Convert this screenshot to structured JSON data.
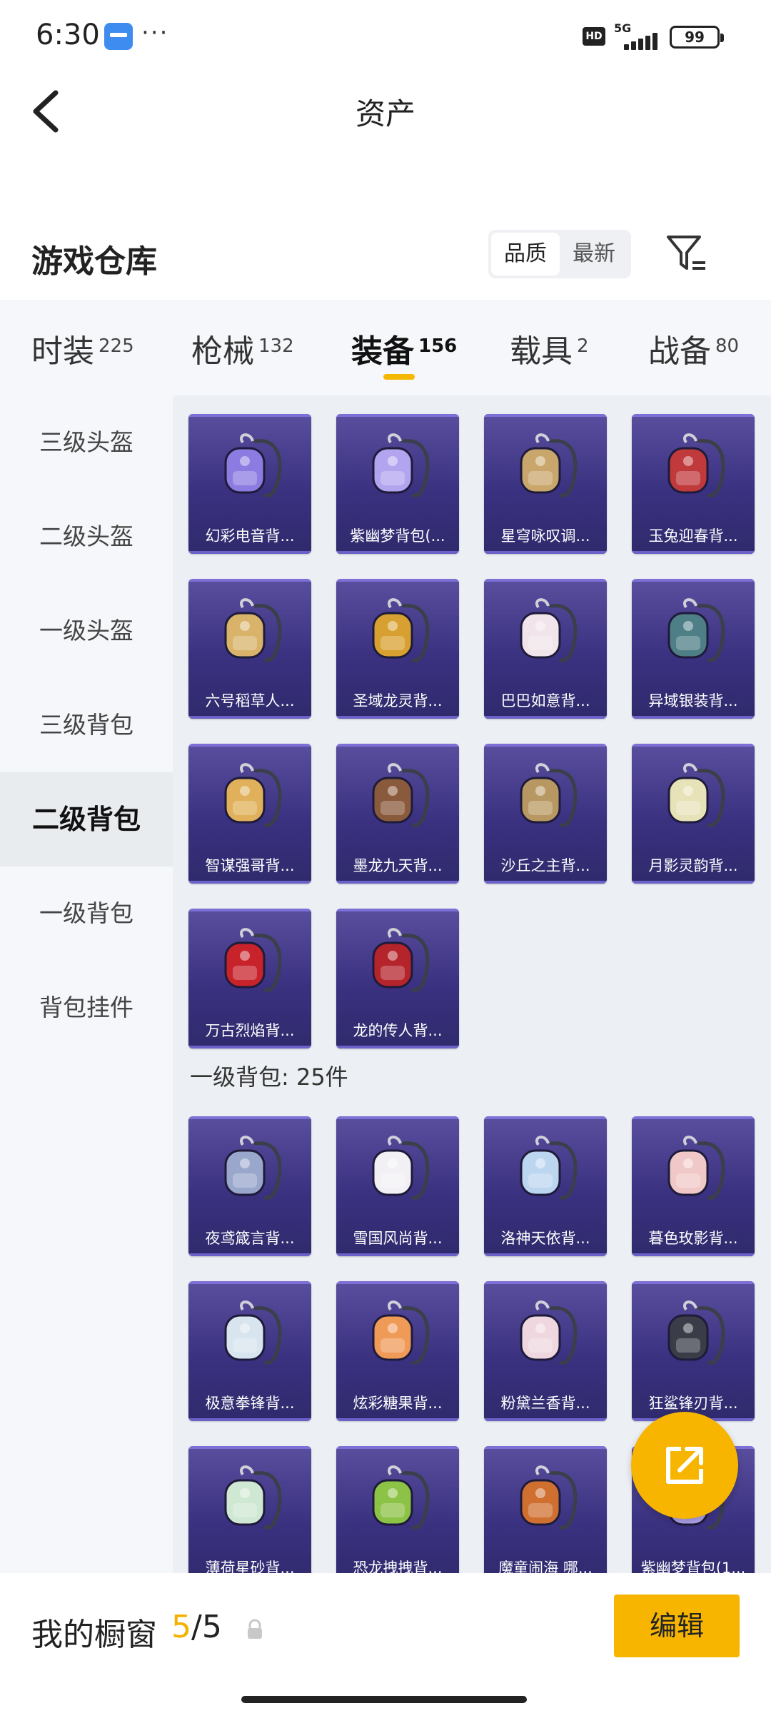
{
  "status_bar": {
    "time": "6:30",
    "more": "···",
    "hd": "HD",
    "network": "5G",
    "battery": "99"
  },
  "header": {
    "title": "资产"
  },
  "warehouse": {
    "title": "游戏仓库",
    "sort_options": [
      "品质",
      "最新"
    ],
    "sort_selected": "品质"
  },
  "tabs": [
    {
      "name": "时装",
      "count": "225"
    },
    {
      "name": "枪械",
      "count": "132"
    },
    {
      "name": "装备",
      "count": "156",
      "active": true
    },
    {
      "name": "载具",
      "count": "2"
    },
    {
      "name": "战备",
      "count": "80"
    }
  ],
  "sidebar": {
    "items": [
      {
        "label": "三级头盔"
      },
      {
        "label": "二级头盔"
      },
      {
        "label": "一级头盔"
      },
      {
        "label": "三级背包"
      },
      {
        "label": "二级背包",
        "active": true
      },
      {
        "label": "一级背包"
      },
      {
        "label": "背包挂件"
      }
    ]
  },
  "grid": {
    "level2_items": [
      {
        "label": "幻彩电音背...",
        "icon": "backpack-icon",
        "color": "#8c7be0"
      },
      {
        "label": "紫幽梦背包(...",
        "icon": "backpack-icon",
        "color": "#b3a4ef"
      },
      {
        "label": "星穹咏叹调...",
        "icon": "backpack-icon",
        "color": "#c9a66b"
      },
      {
        "label": "玉兔迎春背...",
        "icon": "backpack-icon",
        "color": "#c0393b"
      },
      {
        "label": "六号稻草人...",
        "icon": "backpack-icon",
        "color": "#d9b36a"
      },
      {
        "label": "圣域龙灵背...",
        "icon": "backpack-icon",
        "color": "#d8a030"
      },
      {
        "label": "巴巴如意背...",
        "icon": "backpack-icon",
        "color": "#f1e4ea"
      },
      {
        "label": "异域银装背...",
        "icon": "backpack-icon",
        "color": "#4e7e86"
      },
      {
        "label": "智谋强哥背...",
        "icon": "backpack-icon",
        "color": "#e0b15a"
      },
      {
        "label": "墨龙九天背...",
        "icon": "backpack-icon",
        "color": "#8a5a3c"
      },
      {
        "label": "沙丘之主背...",
        "icon": "backpack-icon",
        "color": "#b89862"
      },
      {
        "label": "月影灵韵背...",
        "icon": "backpack-icon",
        "color": "#e8e2b8"
      },
      {
        "label": "万古烈焰背...",
        "icon": "backpack-icon",
        "color": "#c8222b"
      },
      {
        "label": "龙的传人背...",
        "icon": "backpack-icon",
        "color": "#b5232b"
      }
    ],
    "section_title": "一级背包: 25件",
    "level1_items": [
      {
        "label": "夜鸢箴言背...",
        "icon": "backpack-icon",
        "color": "#9aa7cc"
      },
      {
        "label": "雪国风尚背...",
        "icon": "backpack-icon",
        "color": "#f2f0f5"
      },
      {
        "label": "洛神天依背...",
        "icon": "backpack-icon",
        "color": "#bcd6f0"
      },
      {
        "label": "暮色玫影背...",
        "icon": "backpack-icon",
        "color": "#f0c8c8"
      },
      {
        "label": "极意拳锋背...",
        "icon": "backpack-icon",
        "color": "#d8e4ee"
      },
      {
        "label": "炫彩糖果背...",
        "icon": "backpack-icon",
        "color": "#f09a58"
      },
      {
        "label": "粉黛兰香背...",
        "icon": "backpack-icon",
        "color": "#eed7df"
      },
      {
        "label": "狂鲨锋刃背...",
        "icon": "backpack-icon",
        "color": "#3a3d48"
      },
      {
        "label": "薄荷星砂背...",
        "icon": "backpack-icon",
        "color": "#cfe8d3"
      },
      {
        "label": "恐龙拽拽背...",
        "icon": "backpack-icon",
        "color": "#8cc246"
      },
      {
        "label": "魔童闹海 哪...",
        "icon": "backpack-icon",
        "color": "#d07030"
      },
      {
        "label": "紫幽梦背包(1...",
        "icon": "backpack-icon",
        "color": "#b3a4ef"
      }
    ]
  },
  "bottom_bar": {
    "title": "我的橱窗",
    "count_current": "5",
    "count_total": "/5",
    "edit_label": "编辑"
  },
  "colors": {
    "accent": "#f7b500",
    "card_bg": "#3a3180"
  }
}
